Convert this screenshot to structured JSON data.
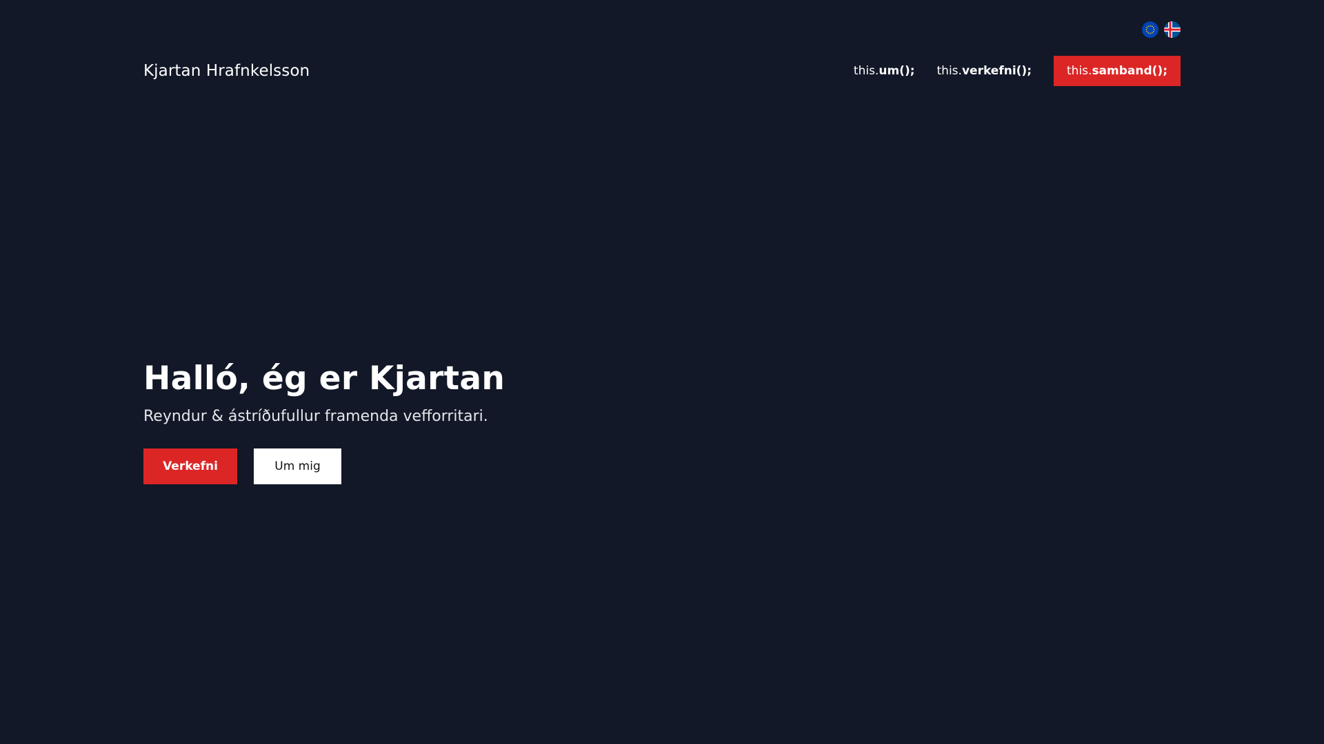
{
  "colors": {
    "background": "#121827",
    "accent": "#dc2626",
    "text": "#ffffff",
    "flag_en_blue": "#0044b5",
    "flag_en_stars": "#ffce00",
    "flag_is_blue": "#02529c",
    "flag_is_red": "#dc1e35"
  },
  "language_switcher": [
    {
      "icon": "eu-flag-icon"
    },
    {
      "icon": "iceland-flag-icon"
    }
  ],
  "header": {
    "brand": "Kjartan Hrafnkelsson",
    "nav": [
      {
        "prefix": "this.",
        "method": "um();"
      },
      {
        "prefix": "this.",
        "method": "verkefni();"
      },
      {
        "prefix": "this.",
        "method": "samband();"
      }
    ]
  },
  "hero": {
    "title": "Halló, ég er Kjartan",
    "subtitle": "Reyndur & ástríðufullur framenda vefforritari.",
    "primary_button": "Verkefni",
    "secondary_button": "Um mig"
  }
}
